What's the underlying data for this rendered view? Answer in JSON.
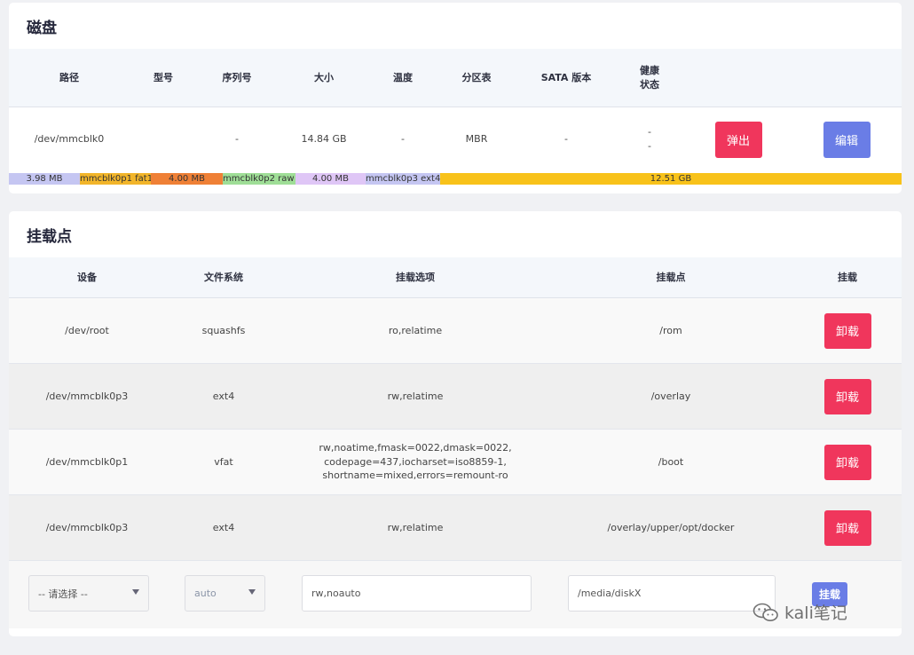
{
  "disk": {
    "title": "磁盘",
    "headers": {
      "path": "路径",
      "model": "型号",
      "serial": "序列号",
      "size": "大小",
      "temp": "温度",
      "ptable": "分区表",
      "sata": "SATA 版本",
      "health_1": "健康",
      "health_2": "状态"
    },
    "row": {
      "path": "/dev/mmcblk0",
      "model": "",
      "serial": "-",
      "size": "14.84 GB",
      "temp": "-",
      "ptable": "MBR",
      "sata": "-",
      "health_1": "-",
      "health_2": "-",
      "eject_label": "弹出",
      "edit_label": "编辑"
    },
    "partitions": [
      {
        "label": "3.98 MB",
        "color": "#c5c6f2"
      },
      {
        "label": "mmcblk0p1 fat1",
        "color": "#f2b52a"
      },
      {
        "label": "4.00 MB",
        "color": "#ef8036"
      },
      {
        "label": "mmcblk0p2 raw",
        "color": "#9fde97"
      },
      {
        "label": "4.00 MB",
        "color": "#dfc6f6"
      },
      {
        "label": "mmcblk0p3 ext4",
        "color": "#c5c6f2"
      },
      {
        "label": "12.51 GB",
        "color": "#f8c21a"
      }
    ]
  },
  "mounts": {
    "title": "挂载点",
    "headers": {
      "device": "设备",
      "fs": "文件系统",
      "options": "挂载选项",
      "point": "挂载点",
      "action": "挂载"
    },
    "rows": [
      {
        "device": "/dev/root",
        "fs": "squashfs",
        "options": "ro,relatime",
        "point": "/rom",
        "action": "卸载"
      },
      {
        "device": "/dev/mmcblk0p3",
        "fs": "ext4",
        "options": "rw,relatime",
        "point": "/overlay",
        "action": "卸载"
      },
      {
        "device": "/dev/mmcblk0p1",
        "fs": "vfat",
        "options": "rw,noatime,fmask=0022,dmask=0022,\ncodepage=437,iocharset=iso8859-1,\nshortname=mixed,errors=remount-ro",
        "point": "/boot",
        "action": "卸载"
      },
      {
        "device": "/dev/mmcblk0p3",
        "fs": "ext4",
        "options": "rw,relatime",
        "point": "/overlay/upper/opt/docker",
        "action": "卸载"
      }
    ],
    "add": {
      "device_value": "-- 请选择 --",
      "fs_value": "auto",
      "options_placeholder": "rw,noauto",
      "mountpoint_placeholder": "/media/diskX",
      "mount_label": "挂载"
    }
  },
  "watermark": {
    "text": "kali笔记"
  }
}
